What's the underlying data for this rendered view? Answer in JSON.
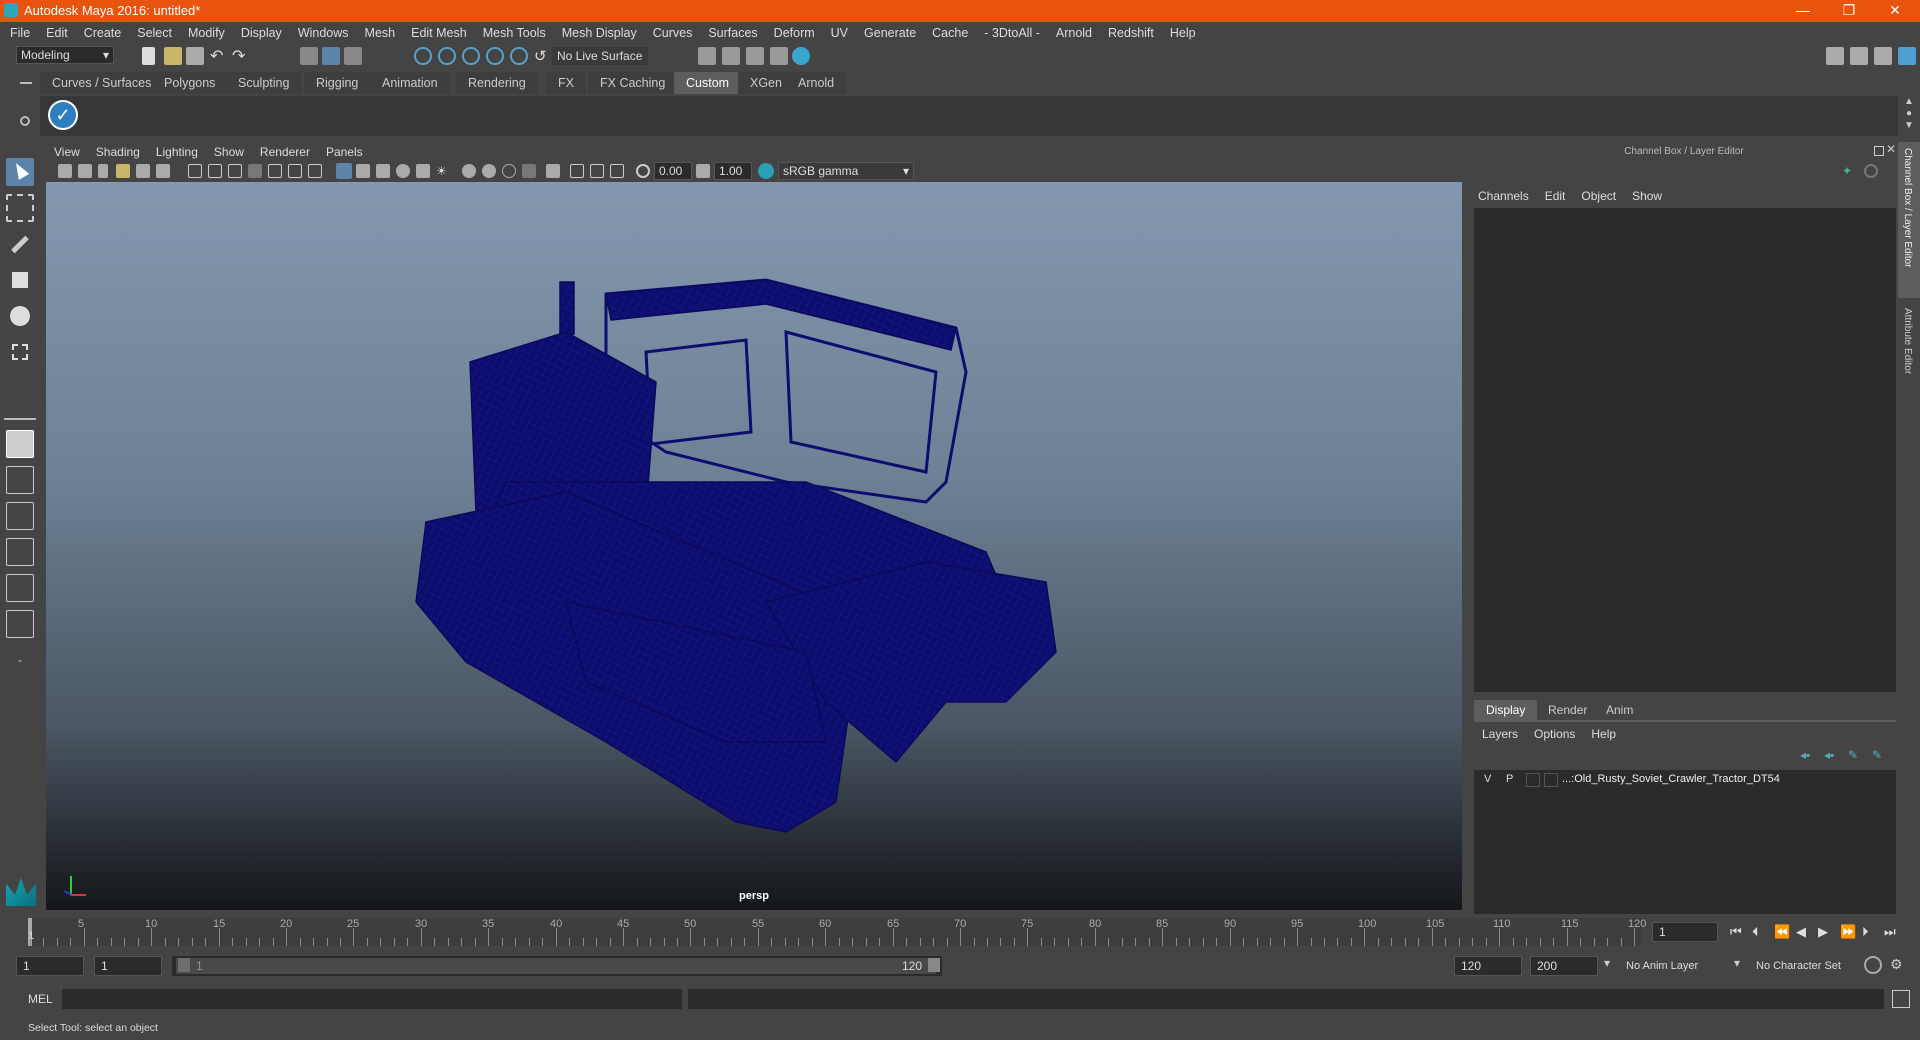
{
  "window": {
    "title": "Autodesk Maya 2016: untitled*",
    "minimize": "—",
    "restore": "❐",
    "close": "✕"
  },
  "menus": [
    "File",
    "Edit",
    "Create",
    "Select",
    "Modify",
    "Display",
    "Windows",
    "Mesh",
    "Edit Mesh",
    "Mesh Tools",
    "Mesh Display",
    "Curves",
    "Surfaces",
    "Deform",
    "UV",
    "Generate",
    "Cache",
    "- 3DtoAll -",
    "Arnold",
    "Redshift",
    "Help"
  ],
  "status_line": {
    "workspace": "Modeling",
    "live_surface": "No Live Surface"
  },
  "shelf_tabs": [
    "Curves / Surfaces",
    "Polygons",
    "Sculpting",
    "Rigging",
    "Animation",
    "Rendering",
    "FX",
    "FX Caching",
    "Custom",
    "XGen",
    "Arnold"
  ],
  "active_shelf": "Custom",
  "viewport": {
    "menus": [
      "View",
      "Shading",
      "Lighting",
      "Show",
      "Renderer",
      "Panels"
    ],
    "exposure": "0.00",
    "gamma": "1.00",
    "color_space": "sRGB gamma",
    "camera_label": "persp"
  },
  "channel_box": {
    "title": "Channel Box / Layer Editor",
    "menus": [
      "Channels",
      "Edit",
      "Object",
      "Show"
    ],
    "side_tabs": [
      "Channel Box / Layer Editor",
      "Attribute Editor"
    ]
  },
  "layer_editor": {
    "tabs": [
      "Display",
      "Render",
      "Anim"
    ],
    "active_tab": "Display",
    "menus": [
      "Layers",
      "Options",
      "Help"
    ],
    "layer": {
      "v": "V",
      "p": "P",
      "name": "...:Old_Rusty_Soviet_Crawler_Tractor_DT54"
    }
  },
  "timeline": {
    "start_marker": "1",
    "ticks": [
      "5",
      "10",
      "15",
      "20",
      "25",
      "30",
      "35",
      "40",
      "45",
      "50",
      "55",
      "60",
      "65",
      "70",
      "75",
      "80",
      "85",
      "90",
      "95",
      "100",
      "105",
      "110",
      "115",
      "120"
    ],
    "current_frame": "1"
  },
  "range": {
    "start": "1",
    "playback_start": "1",
    "slider_start": "1",
    "slider_end": "120",
    "playback_end": "120",
    "end": "200",
    "anim_layer": "No Anim Layer",
    "character_set": "No Character Set"
  },
  "command_line": {
    "label": "MEL"
  },
  "help_line": "Select Tool: select an object"
}
